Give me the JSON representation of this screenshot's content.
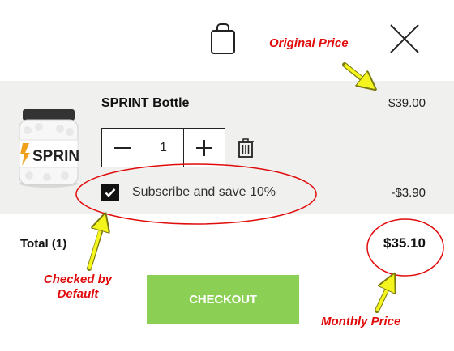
{
  "header": {
    "bag_icon": "shopping-bag-icon",
    "close_icon": "close-x-icon"
  },
  "cart_item": {
    "image_label": "SPRIN",
    "name": "SPRINT Bottle",
    "price": "$39.00",
    "quantity": "1",
    "decrease_icon": "minus-icon",
    "increase_icon": "plus-icon",
    "remove_icon": "trash-icon",
    "subscribe": {
      "checked": true,
      "label": "Subscribe and save 10%",
      "discount": "-$3.90"
    }
  },
  "summary": {
    "total_label": "Total (1)",
    "total_value": "$35.10"
  },
  "checkout": {
    "label": "CHECKOUT",
    "color": "#8ccf55"
  },
  "annotations": {
    "original_price": "Original Price",
    "checked_by_default_line1": "Checked by",
    "checked_by_default_line2": "Default",
    "monthly_price": "Monthly Price",
    "color": "#e10b0b",
    "arrow_color": "#f5f51e"
  }
}
